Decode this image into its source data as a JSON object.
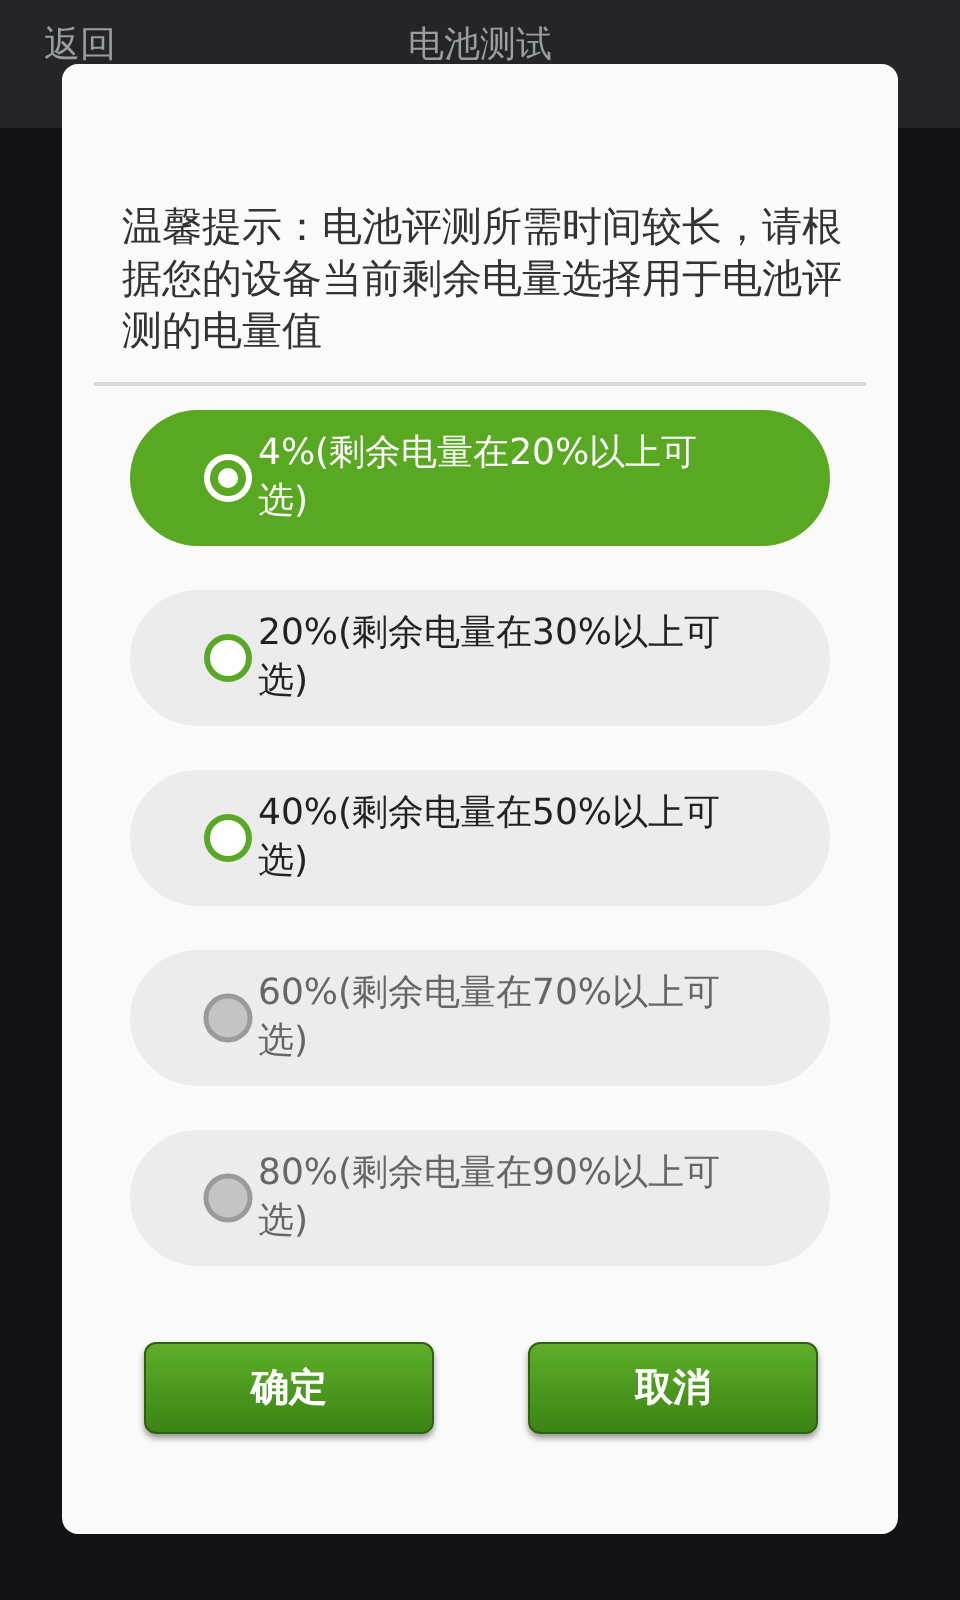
{
  "app_bar": {
    "back": "返回",
    "title": "电池测试"
  },
  "dialog": {
    "message": "温馨提示：电池评测所需时间较长，请根据您的设备当前剩余电量选择用于电池评测的电量值",
    "options": [
      {
        "label": "4%(剩余电量在20%以上可选)",
        "selected": true,
        "disabled": false
      },
      {
        "label": "20%(剩余电量在30%以上可选)",
        "selected": false,
        "disabled": false
      },
      {
        "label": "40%(剩余电量在50%以上可选)",
        "selected": false,
        "disabled": false
      },
      {
        "label": "60%(剩余电量在70%以上可选)",
        "selected": false,
        "disabled": true
      },
      {
        "label": "80%(剩余电量在90%以上可选)",
        "selected": false,
        "disabled": true
      }
    ],
    "buttons": [
      "确定",
      "取消"
    ]
  }
}
